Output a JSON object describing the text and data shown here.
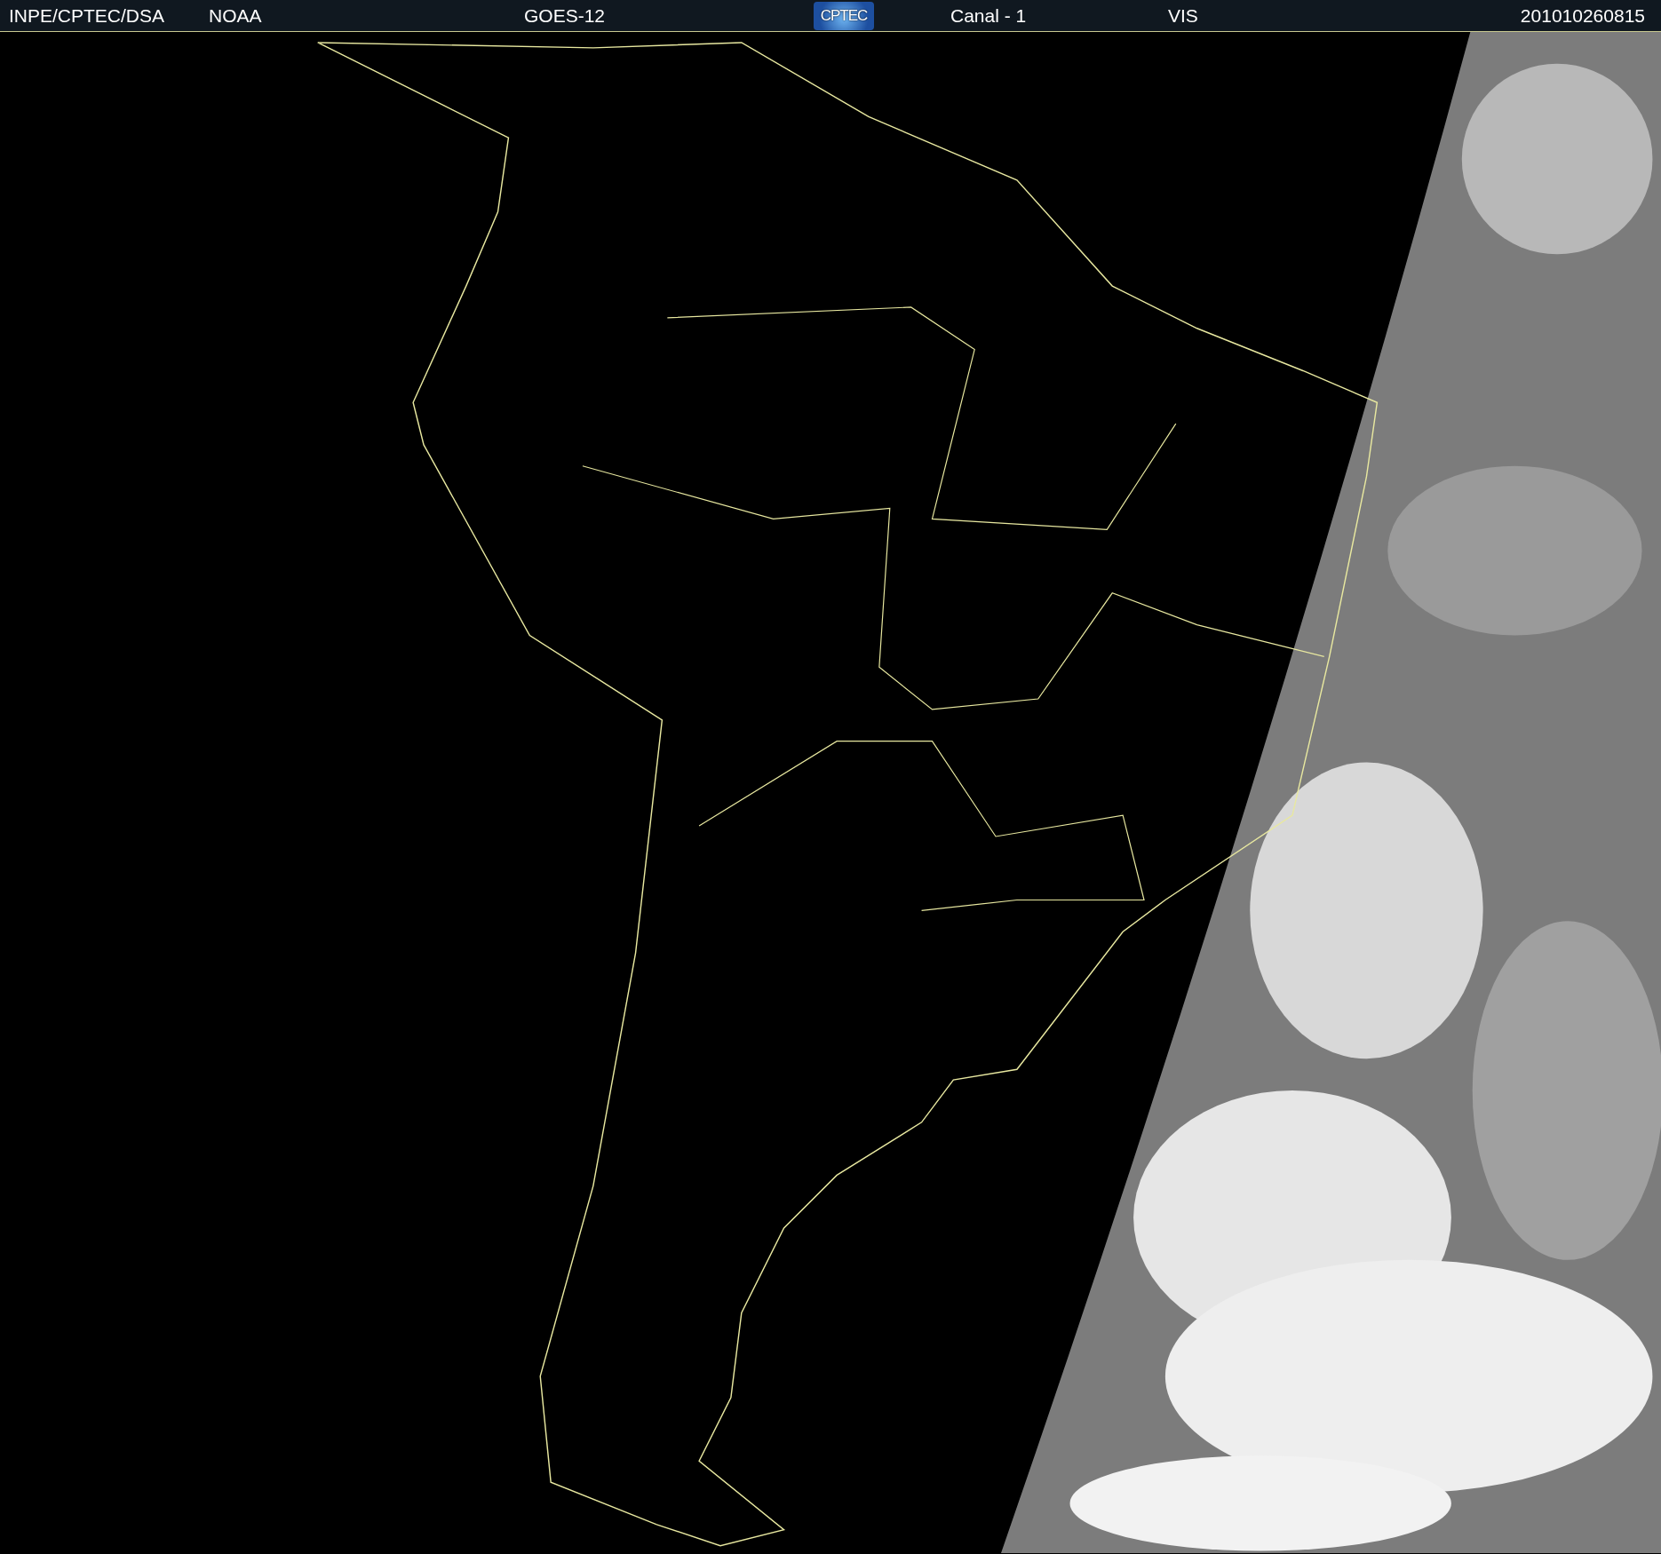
{
  "header": [
    {
      "kind": "text",
      "text": "INPE/CPTEC/DSA"
    },
    {
      "kind": "text",
      "text": "NOAA"
    },
    {
      "kind": "text",
      "text": "GOES-12"
    },
    {
      "kind": "logo",
      "text": "CPTEC"
    },
    {
      "kind": "text",
      "text": "Canal - 1"
    },
    {
      "kind": "text",
      "text": "VIS"
    },
    {
      "kind": "text",
      "text": "201010260815"
    }
  ]
}
